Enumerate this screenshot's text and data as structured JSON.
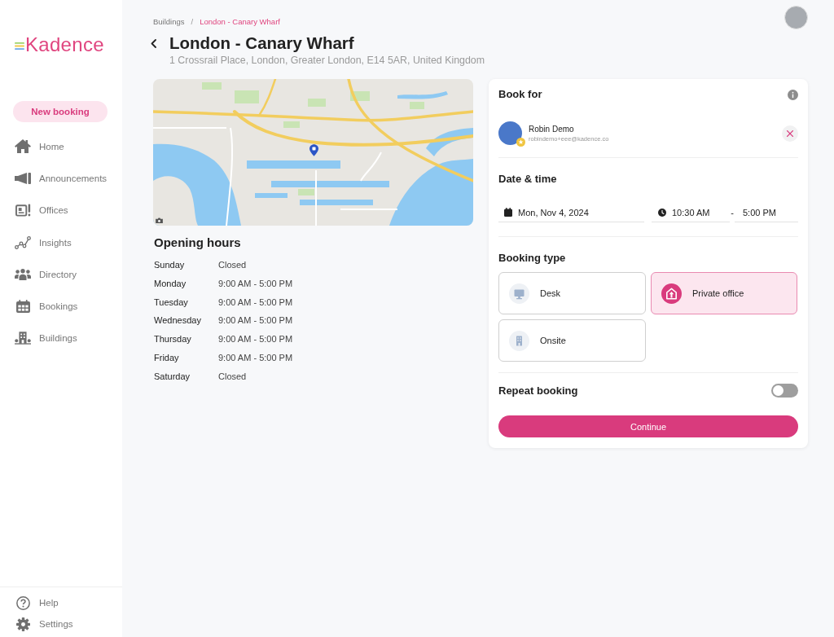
{
  "sidebar": {
    "logo": "Kadence",
    "new_booking_button": "New booking",
    "items": [
      {
        "label": "Home",
        "selected": false
      },
      {
        "label": "Announcements",
        "selected": false
      },
      {
        "label": "Offices",
        "selected": false
      },
      {
        "label": "Insights",
        "selected": false
      },
      {
        "label": "Directory",
        "selected": false
      },
      {
        "label": "Bookings",
        "selected": false
      },
      {
        "label": "Buildings",
        "selected": false
      }
    ],
    "footer_items": [
      {
        "label": "Help"
      },
      {
        "label": "Settings"
      }
    ]
  },
  "breadcrumb": {
    "separator": "/",
    "items": [
      {
        "label": "Buildings",
        "current": false
      },
      {
        "label": "London - Canary Wharf",
        "current": true
      }
    ]
  },
  "header": {
    "title": "London - Canary Wharf",
    "address": "1 Crossrail Place, London, Greater London, E14 5AR, United Kingdom"
  },
  "opening_hours": {
    "title": "Opening hours",
    "rows": [
      {
        "day": "Sunday",
        "hours": "Closed"
      },
      {
        "day": "Monday",
        "hours": "9:00 AM - 5:00 PM"
      },
      {
        "day": "Tuesday",
        "hours": "9:00 AM - 5:00 PM"
      },
      {
        "day": "Wednesday",
        "hours": "9:00 AM - 5:00 PM"
      },
      {
        "day": "Thursday",
        "hours": "9:00 AM - 5:00 PM"
      },
      {
        "day": "Friday",
        "hours": "9:00 AM - 5:00 PM"
      },
      {
        "day": "Saturday",
        "hours": "Closed"
      }
    ]
  },
  "booking_panel": {
    "book_for": {
      "title": "Book for",
      "person": {
        "name": "Robin Demo",
        "email": "robindemo+eee@kadence.co"
      }
    },
    "date_time": {
      "title": "Date & time",
      "date": "Mon, Nov 4, 2024",
      "start_time": "10:30 AM",
      "separator": "-",
      "end_time": "5:00 PM"
    },
    "booking_type": {
      "title": "Booking type",
      "options": [
        {
          "label": "Desk",
          "selected": false
        },
        {
          "label": "Private office",
          "selected": true
        },
        {
          "label": "Onsite",
          "selected": false
        }
      ]
    },
    "repeat_booking": {
      "label": "Repeat booking",
      "on": false
    },
    "continue_button": "Continue"
  }
}
